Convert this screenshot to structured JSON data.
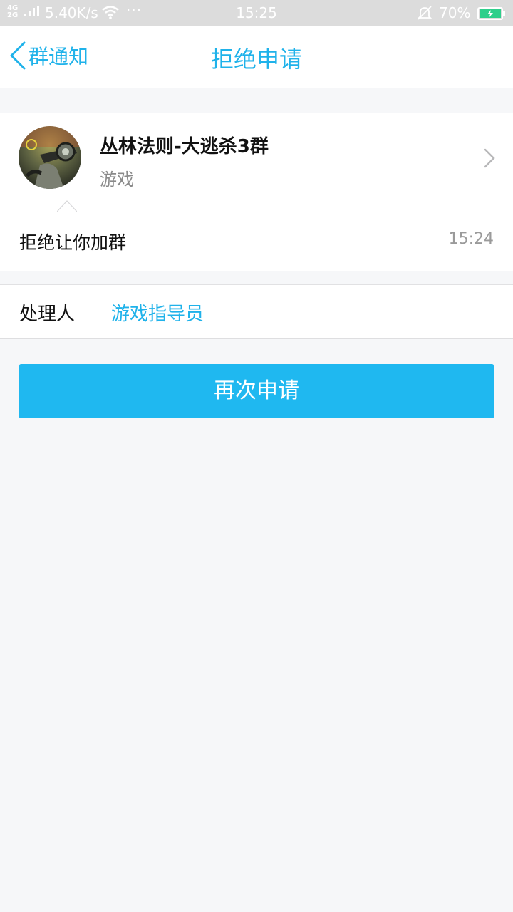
{
  "status_bar": {
    "network": "4G",
    "network2": "2G",
    "speed": "5.40K/s",
    "more": "···",
    "time": "15:25",
    "battery_percent": "70%"
  },
  "header": {
    "back_label": "群通知",
    "title": "拒绝申请"
  },
  "group": {
    "name": "丛林法则-大逃杀3群",
    "category": "游戏"
  },
  "message": {
    "text": "拒绝让你加群",
    "time": "15:24"
  },
  "handler": {
    "label": "处理人",
    "name": "游戏指导员"
  },
  "actions": {
    "reapply_label": "再次申请"
  },
  "colors": {
    "accent": "#1fb2ea",
    "button": "#1fb8f0",
    "background": "#f6f7f9"
  }
}
